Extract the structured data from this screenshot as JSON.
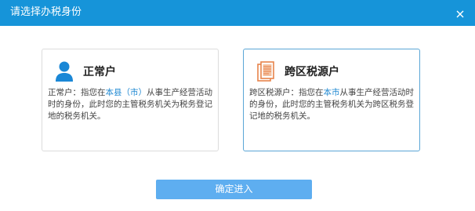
{
  "dialog": {
    "title": "请选择办税身份",
    "close_icon": "close-icon",
    "accent_color": "#1694d9"
  },
  "identities": [
    {
      "title": "正常户",
      "icon": "person-icon",
      "desc_before": "正常户：指您在",
      "desc_highlight": "本县（市）",
      "desc_after": "从事生产经营活动时的身份，此时您的主管税务机关为税务登记地的税务机关。",
      "selected": false
    },
    {
      "title": "跨区税源户",
      "icon": "document-icon",
      "desc_before": "跨区税源户：指您在",
      "desc_highlight": "本市",
      "desc_after": "从事生产经营活动时的身份，此时您的主管税务机关为跨区税务登记地的税务机关。",
      "selected": true
    }
  ],
  "confirm_label": "确定进入",
  "colors": {
    "highlight": "#1e88d2",
    "selected_border": "#5aa6d6",
    "button": "#5eaef0",
    "document_icon": "#e8834a",
    "person_icon": "#1a87d6"
  }
}
